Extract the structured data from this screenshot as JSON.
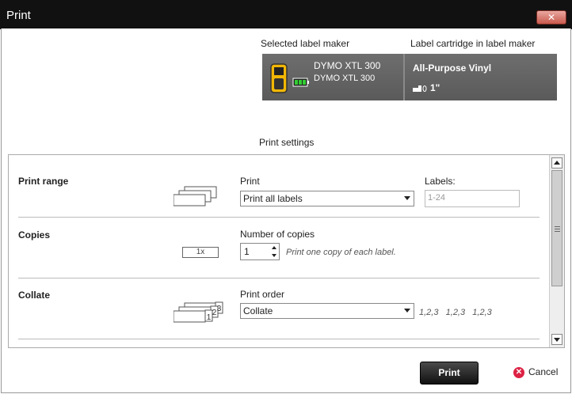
{
  "window": {
    "title": "Print",
    "close_glyph": "✕"
  },
  "header": {
    "selected_maker_label": "Selected label maker",
    "cartridge_label": "Label cartridge in label maker"
  },
  "device": {
    "name": "DYMO XTL 300",
    "model": "DYMO XTL 300",
    "cartridge": "All-Purpose Vinyl",
    "cartridge_size": "1\""
  },
  "settings": {
    "title": "Print settings",
    "print_range": {
      "title": "Print range",
      "print_label": "Print",
      "print_value": "Print all labels",
      "labels_label": "Labels:",
      "labels_placeholder": "1-24"
    },
    "copies": {
      "title": "Copies",
      "badge": "1x",
      "number_label": "Number of copies",
      "number_value": "1",
      "hint": "Print one copy of each label."
    },
    "collate": {
      "title": "Collate",
      "order_label": "Print order",
      "order_value": "Collate",
      "sequence": [
        "1,2,3",
        "1,2,3",
        "1,2,3"
      ],
      "icon_digits": [
        "1",
        "2",
        "3"
      ]
    }
  },
  "buttons": {
    "print": "Print",
    "cancel": "Cancel",
    "cancel_glyph": "✕"
  }
}
